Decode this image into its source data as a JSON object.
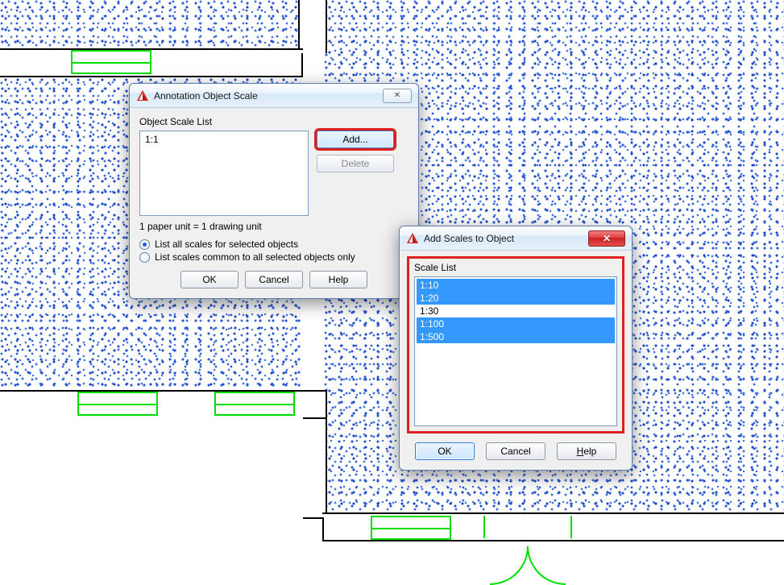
{
  "dialog1": {
    "title": "Annotation Object Scale",
    "section_label": "Object Scale List",
    "list_items": [
      "1:1"
    ],
    "add_label": "Add...",
    "delete_label": "Delete",
    "unit_text": "1 paper unit = 1 drawing unit",
    "radio_all": "List all scales for selected objects",
    "radio_common": "List scales common to all selected objects only",
    "ok_label": "OK",
    "cancel_label": "Cancel",
    "help_label": "Help"
  },
  "dialog2": {
    "title": "Add Scales to Object",
    "section_label": "Scale List",
    "items": [
      {
        "label": "1:10",
        "selected": true
      },
      {
        "label": "1:20",
        "selected": true
      },
      {
        "label": "1:30",
        "selected": false
      },
      {
        "label": "1:100",
        "selected": true
      },
      {
        "label": "1:500",
        "selected": true
      }
    ],
    "ok_label": "OK",
    "cancel_label": "Cancel",
    "help_label": "Help",
    "help_underline": "H",
    "help_rest": "elp"
  }
}
